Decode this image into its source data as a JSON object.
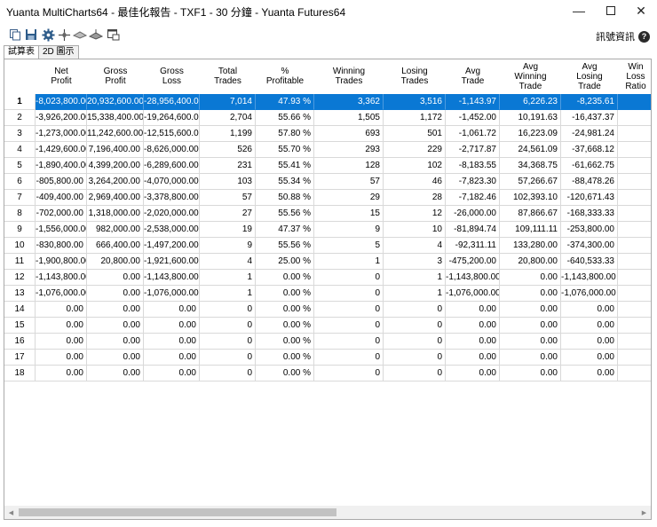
{
  "window": {
    "title": "Yuanta MultiCharts64 - 最佳化報告 - TXF1 - 30 分鐘 - Yuanta Futures64",
    "minimize": "—",
    "close": "✕"
  },
  "toolbar": {
    "icons": [
      "copy-icon",
      "save-icon",
      "settings-gear-icon",
      "column-icon",
      "flat-icon",
      "filter-icon",
      "window-icon"
    ],
    "info_label": "訊號資訊",
    "help_glyph": "?"
  },
  "tabs": [
    {
      "label": "試算表",
      "active": true
    },
    {
      "label": "2D 圖示",
      "active": false
    }
  ],
  "table": {
    "headers": [
      "",
      "Net\nProfit",
      "Gross\nProfit",
      "Gross\nLoss",
      "Total\nTrades",
      "%\nProfitable",
      "Winning\nTrades",
      "Losing\nTrades",
      "Avg\nTrade",
      "Avg\nWinning\nTrade",
      "Avg\nLosing\nTrade",
      "Win\nLoss\nRatio"
    ],
    "selected_row": 0,
    "rows": [
      [
        "1",
        "-8,023,800.00",
        "20,932,600.00",
        "-28,956,400.00",
        "7,014",
        "47.93 %",
        "3,362",
        "3,516",
        "-1,143.97",
        "6,226.23",
        "-8,235.61",
        ""
      ],
      [
        "2",
        "-3,926,200.00",
        "15,338,400.00",
        "-19,264,600.00",
        "2,704",
        "55.66 %",
        "1,505",
        "1,172",
        "-1,452.00",
        "10,191.63",
        "-16,437.37",
        ""
      ],
      [
        "3",
        "-1,273,000.00",
        "11,242,600.00",
        "-12,515,600.00",
        "1,199",
        "57.80 %",
        "693",
        "501",
        "-1,061.72",
        "16,223.09",
        "-24,981.24",
        ""
      ],
      [
        "4",
        "-1,429,600.00",
        "7,196,400.00",
        "-8,626,000.00",
        "526",
        "55.70 %",
        "293",
        "229",
        "-2,717.87",
        "24,561.09",
        "-37,668.12",
        ""
      ],
      [
        "5",
        "-1,890,400.00",
        "4,399,200.00",
        "-6,289,600.00",
        "231",
        "55.41 %",
        "128",
        "102",
        "-8,183.55",
        "34,368.75",
        "-61,662.75",
        ""
      ],
      [
        "6",
        "-805,800.00",
        "3,264,200.00",
        "-4,070,000.00",
        "103",
        "55.34 %",
        "57",
        "46",
        "-7,823.30",
        "57,266.67",
        "-88,478.26",
        ""
      ],
      [
        "7",
        "-409,400.00",
        "2,969,400.00",
        "-3,378,800.00",
        "57",
        "50.88 %",
        "29",
        "28",
        "-7,182.46",
        "102,393.10",
        "-120,671.43",
        ""
      ],
      [
        "8",
        "-702,000.00",
        "1,318,000.00",
        "-2,020,000.00",
        "27",
        "55.56 %",
        "15",
        "12",
        "-26,000.00",
        "87,866.67",
        "-168,333.33",
        ""
      ],
      [
        "9",
        "-1,556,000.00",
        "982,000.00",
        "-2,538,000.00",
        "19",
        "47.37 %",
        "9",
        "10",
        "-81,894.74",
        "109,111.11",
        "-253,800.00",
        ""
      ],
      [
        "10",
        "-830,800.00",
        "666,400.00",
        "-1,497,200.00",
        "9",
        "55.56 %",
        "5",
        "4",
        "-92,311.11",
        "133,280.00",
        "-374,300.00",
        ""
      ],
      [
        "11",
        "-1,900,800.00",
        "20,800.00",
        "-1,921,600.00",
        "4",
        "25.00 %",
        "1",
        "3",
        "-475,200.00",
        "20,800.00",
        "-640,533.33",
        ""
      ],
      [
        "12",
        "-1,143,800.00",
        "0.00",
        "-1,143,800.00",
        "1",
        "0.00 %",
        "0",
        "1",
        "-1,143,800.00",
        "0.00",
        "-1,143,800.00",
        ""
      ],
      [
        "13",
        "-1,076,000.00",
        "0.00",
        "-1,076,000.00",
        "1",
        "0.00 %",
        "0",
        "1",
        "-1,076,000.00",
        "0.00",
        "-1,076,000.00",
        ""
      ],
      [
        "14",
        "0.00",
        "0.00",
        "0.00",
        "0",
        "0.00 %",
        "0",
        "0",
        "0.00",
        "0.00",
        "0.00",
        ""
      ],
      [
        "15",
        "0.00",
        "0.00",
        "0.00",
        "0",
        "0.00 %",
        "0",
        "0",
        "0.00",
        "0.00",
        "0.00",
        ""
      ],
      [
        "16",
        "0.00",
        "0.00",
        "0.00",
        "0",
        "0.00 %",
        "0",
        "0",
        "0.00",
        "0.00",
        "0.00",
        ""
      ],
      [
        "17",
        "0.00",
        "0.00",
        "0.00",
        "0",
        "0.00 %",
        "0",
        "0",
        "0.00",
        "0.00",
        "0.00",
        ""
      ],
      [
        "18",
        "0.00",
        "0.00",
        "0.00",
        "0",
        "0.00 %",
        "0",
        "0",
        "0.00",
        "0.00",
        "0.00",
        ""
      ]
    ]
  },
  "colors": {
    "selection": "#0a78d4",
    "grid_line": "#d9d9d9"
  }
}
